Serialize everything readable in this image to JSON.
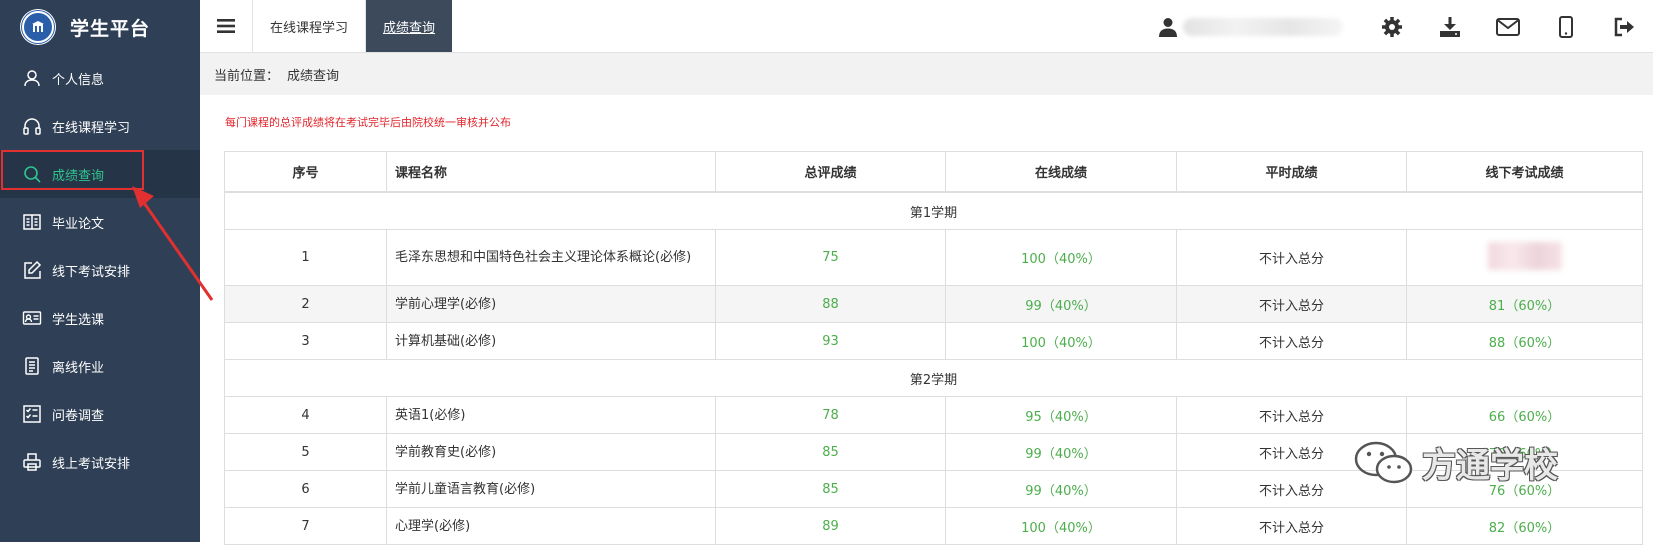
{
  "app": {
    "title": "学生平台"
  },
  "sidebar": {
    "items": [
      {
        "label": "个人信息",
        "icon": "user-icon"
      },
      {
        "label": "在线课程学习",
        "icon": "headphones-icon"
      },
      {
        "label": "成绩查询",
        "icon": "search-icon",
        "active": true
      },
      {
        "label": "毕业论文",
        "icon": "book-icon"
      },
      {
        "label": "线下考试安排",
        "icon": "edit-icon"
      },
      {
        "label": "学生选课",
        "icon": "id-card-icon"
      },
      {
        "label": "离线作业",
        "icon": "document-icon"
      },
      {
        "label": "问卷调查",
        "icon": "checklist-icon"
      },
      {
        "label": "线上考试安排",
        "icon": "printer-icon"
      }
    ]
  },
  "topbar": {
    "tabs": [
      {
        "label": "在线课程学习"
      },
      {
        "label": "成绩查询",
        "active": true
      }
    ],
    "tools": [
      "settings-icon",
      "download-icon",
      "mail-icon",
      "mobile-icon",
      "logout-icon"
    ]
  },
  "breadcrumb": {
    "prefix": "当前位置：",
    "current": "成绩查询"
  },
  "notice": "每门课程的总评成绩将在考试完毕后由院校统一审核并公布",
  "table": {
    "headers": [
      "序号",
      "课程名称",
      "总评成绩",
      "在线成绩",
      "平时成绩",
      "线下考试成绩"
    ],
    "terms": [
      {
        "label": "第1学期",
        "rows": [
          {
            "no": "1",
            "course": "毛泽东思想和中国特色社会主义理论体系概论(必修)",
            "total": "75",
            "online": "100（40%）",
            "usual": "不计入总分",
            "offline": ""
          },
          {
            "no": "2",
            "course": "学前心理学(必修)",
            "total": "88",
            "online": "99（40%）",
            "usual": "不计入总分",
            "offline": "81（60%）"
          },
          {
            "no": "3",
            "course": "计算机基础(必修)",
            "total": "93",
            "online": "100（40%）",
            "usual": "不计入总分",
            "offline": "88（60%）"
          }
        ]
      },
      {
        "label": "第2学期",
        "rows": [
          {
            "no": "4",
            "course": "英语1(必修)",
            "total": "78",
            "online": "95（40%）",
            "usual": "不计入总分",
            "offline": "66（60%）"
          },
          {
            "no": "5",
            "course": "学前教育史(必修)",
            "total": "85",
            "online": "99（40%）",
            "usual": "不计入总分",
            "offline": "76（60%）"
          },
          {
            "no": "6",
            "course": "学前儿童语言教育(必修)",
            "total": "85",
            "online": "99（40%）",
            "usual": "不计入总分",
            "offline": "76（60%）"
          },
          {
            "no": "7",
            "course": "心理学(必修)",
            "total": "89",
            "online": "100（40%）",
            "usual": "不计入总分",
            "offline": "82（60%）"
          }
        ]
      }
    ]
  },
  "watermark": {
    "text": "方通学校"
  },
  "colors": {
    "sidebar": "#2f3f55",
    "accent_green": "#2fc48f",
    "score_green": "#4cae4c",
    "notice_red": "#e0262c",
    "highlight_red": "#e03030"
  }
}
